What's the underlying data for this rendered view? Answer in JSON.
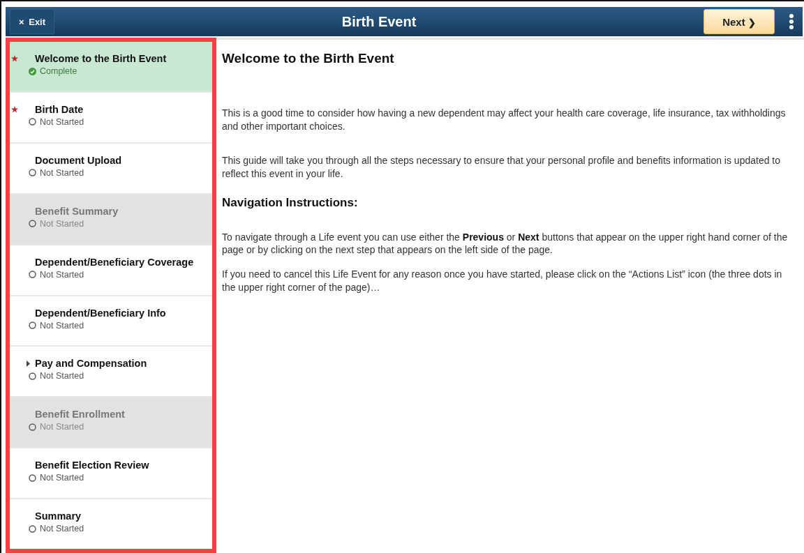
{
  "header": {
    "exit_label": "Exit",
    "exit_icon": "×",
    "title": "Birth Event",
    "next_label": "Next",
    "next_icon": "❯"
  },
  "steps": [
    {
      "label": "Welcome to the Birth Event",
      "status": "Complete",
      "complete": true,
      "required": true,
      "selected": true,
      "disabled": false,
      "expandable": false
    },
    {
      "label": "Birth Date",
      "status": "Not Started",
      "complete": false,
      "required": true,
      "selected": false,
      "disabled": false,
      "expandable": false
    },
    {
      "label": "Document Upload",
      "status": "Not Started",
      "complete": false,
      "required": false,
      "selected": false,
      "disabled": false,
      "expandable": false
    },
    {
      "label": "Benefit Summary",
      "status": "Not Started",
      "complete": false,
      "required": false,
      "selected": false,
      "disabled": true,
      "expandable": false
    },
    {
      "label": "Dependent/Beneficiary Coverage",
      "status": "Not Started",
      "complete": false,
      "required": false,
      "selected": false,
      "disabled": false,
      "expandable": false
    },
    {
      "label": "Dependent/Beneficiary Info",
      "status": "Not Started",
      "complete": false,
      "required": false,
      "selected": false,
      "disabled": false,
      "expandable": false
    },
    {
      "label": "Pay and Compensation",
      "status": "Not Started",
      "complete": false,
      "required": false,
      "selected": false,
      "disabled": false,
      "expandable": true
    },
    {
      "label": "Benefit Enrollment",
      "status": "Not Started",
      "complete": false,
      "required": false,
      "selected": false,
      "disabled": true,
      "expandable": false
    },
    {
      "label": "Benefit Election Review",
      "status": "Not Started",
      "complete": false,
      "required": false,
      "selected": false,
      "disabled": false,
      "expandable": false
    },
    {
      "label": "Summary",
      "status": "Not Started",
      "complete": false,
      "required": false,
      "selected": false,
      "disabled": false,
      "expandable": false
    }
  ],
  "content": [
    {
      "kind": "heading",
      "text": "Welcome to the Birth Event"
    },
    {
      "kind": "paragraph",
      "text": "This is a good time to consider how having a new dependent may affect your health care coverage, life insurance, tax withholdings and other important choices."
    },
    {
      "kind": "paragraph",
      "text": "This guide will take you through all the steps necessary to ensure that your personal profile and benefits information is updated to reflect this event in your life."
    },
    {
      "kind": "subheading",
      "text": "Navigation Instructions:"
    },
    {
      "kind": "paragraph",
      "text": "To navigate through a Life event you can use either the **Previous** or **Next** buttons that appear on the upper right hand corner of the page or by clicking on the next step that appears on the left side of the page."
    },
    {
      "kind": "note",
      "text": "If you need to cancel this Life Event for any reason once you have started, please click on the “Actions List” icon (the three dots in the upper right corner of the page)…"
    }
  ]
}
